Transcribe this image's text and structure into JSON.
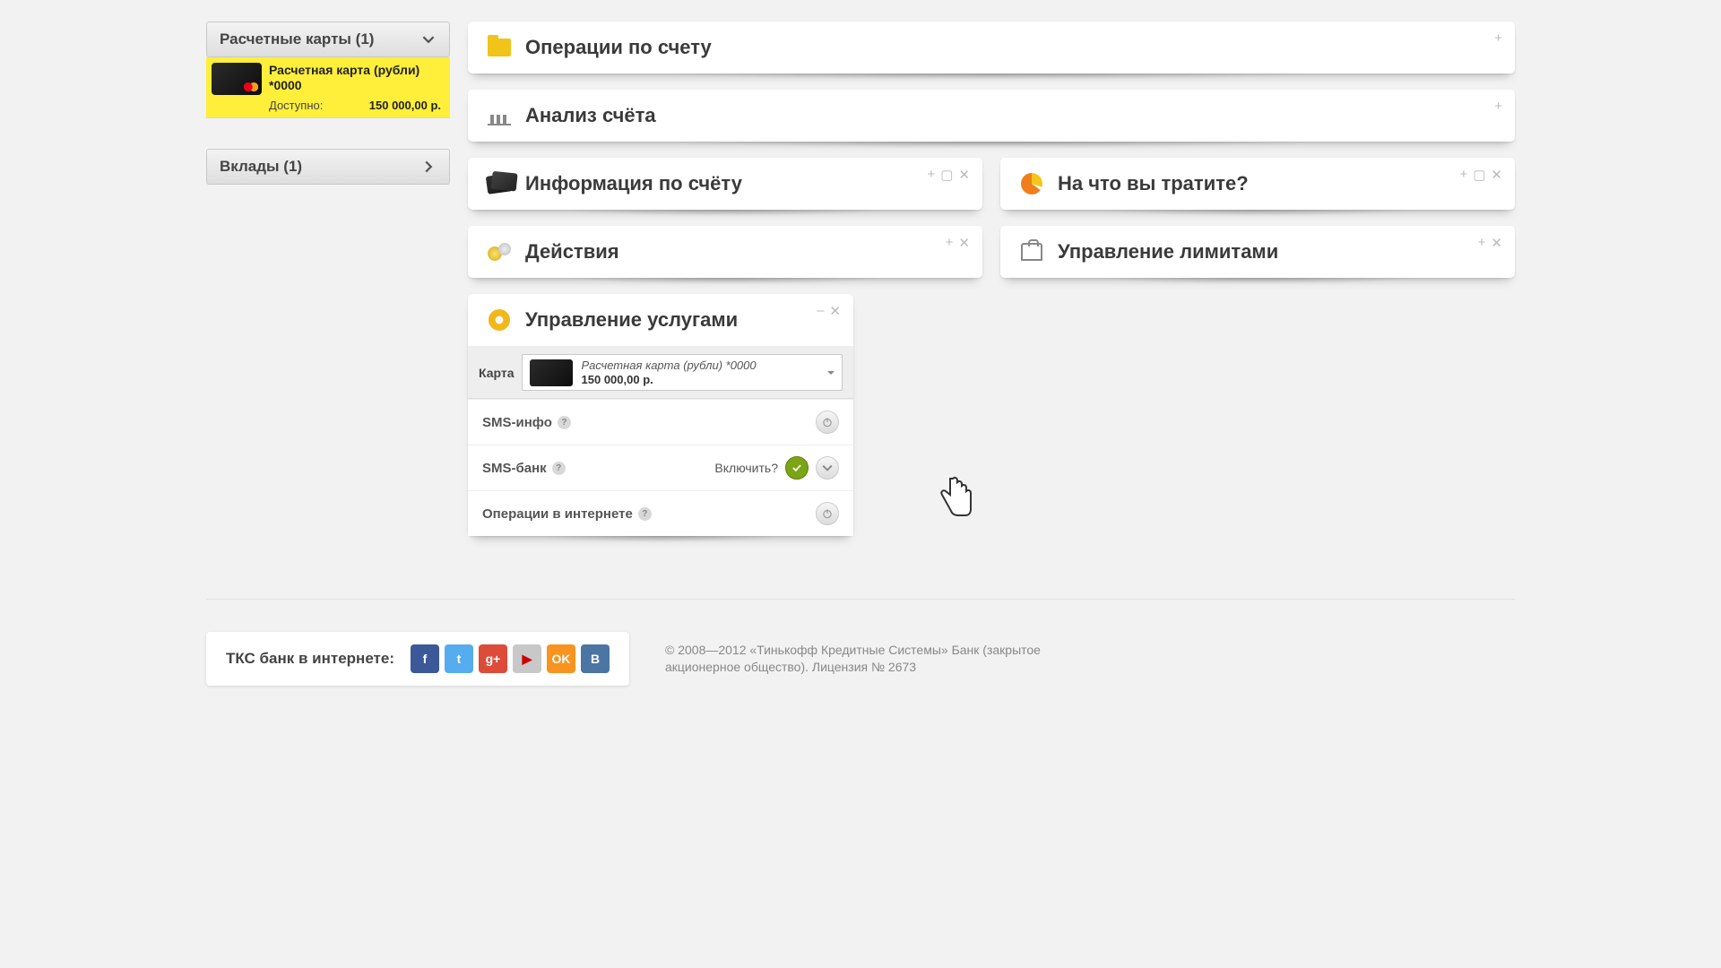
{
  "sidebar": {
    "cards_header": "Расчетные карты (1)",
    "deposits_header": "Вклады (1)",
    "card": {
      "name": "Расчетная карта (рубли)",
      "mask": "*0000",
      "available_label": "Доступно:",
      "available_amount": "150 000,00 р."
    }
  },
  "panels": {
    "operations": "Операции по счету",
    "analysis": "Анализ счёта",
    "info": "Информация по счёту",
    "spending": "На что вы тратите?",
    "actions": "Действия",
    "limits": "Управление лимитами",
    "services": "Управление услугами"
  },
  "services": {
    "card_label": "Карта",
    "card_name": "Расчетная карта (рубли) *0000",
    "card_balance": "150 000,00 р.",
    "sms_info": "SMS-инфо",
    "sms_bank": "SMS-банк",
    "enable_question": "Включить?",
    "internet_ops": "Операции в интернете"
  },
  "footer": {
    "title": "ТКС банк в интернете:",
    "copyright": "© 2008—2012 «Тинькофф Кредитные Системы» Банк (закрытое акционерное общество). Лицензия № 2673"
  },
  "social": {
    "fb": "f",
    "tw": "t",
    "gp": "g+",
    "yt": "▶",
    "ok": "OK",
    "vk": "B"
  }
}
